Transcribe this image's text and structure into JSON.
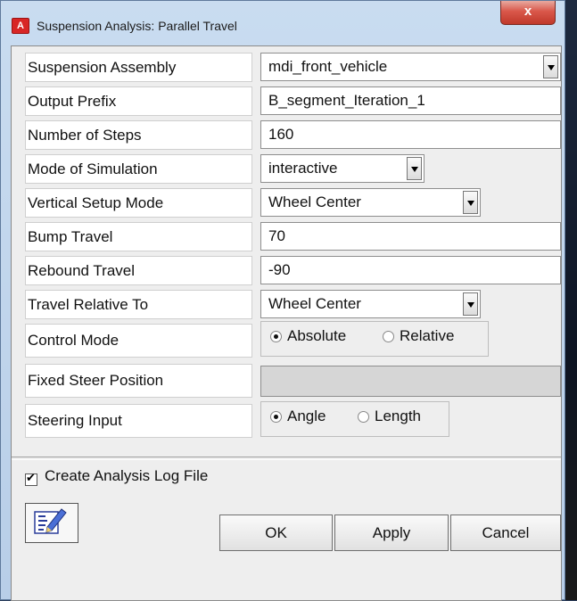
{
  "window": {
    "app_icon_letter": "A",
    "title": "Suspension Analysis: Parallel Travel",
    "close_label": "x"
  },
  "fields": {
    "suspension_assembly": {
      "label": "Suspension Assembly",
      "value": "mdi_front_vehicle"
    },
    "output_prefix": {
      "label": "Output Prefix",
      "value": "B_segment_Iteration_1"
    },
    "number_of_steps": {
      "label": "Number of Steps",
      "value": "160"
    },
    "mode_of_simulation": {
      "label": "Mode of Simulation",
      "value": "interactive"
    },
    "vertical_setup_mode": {
      "label": "Vertical Setup Mode",
      "value": "Wheel Center"
    },
    "bump_travel": {
      "label": "Bump Travel",
      "value": "70"
    },
    "rebound_travel": {
      "label": "Rebound Travel",
      "value": "-90"
    },
    "travel_relative_to": {
      "label": "Travel Relative To",
      "value": "Wheel Center"
    },
    "control_mode": {
      "label": "Control Mode",
      "options": [
        "Absolute",
        "Relative"
      ],
      "selected": "Absolute"
    },
    "fixed_steer_position": {
      "label": "Fixed Steer Position",
      "value": ""
    },
    "steering_input": {
      "label": "Steering Input",
      "options": [
        "Angle",
        "Length"
      ],
      "selected": "Angle"
    }
  },
  "log_file": {
    "label": "Create Analysis Log File",
    "checked": true
  },
  "buttons": {
    "ok": "OK",
    "apply": "Apply",
    "cancel": "Cancel"
  },
  "icons": {
    "edit_table": "edit-table-icon",
    "dropdown": "chevron-down-icon"
  }
}
